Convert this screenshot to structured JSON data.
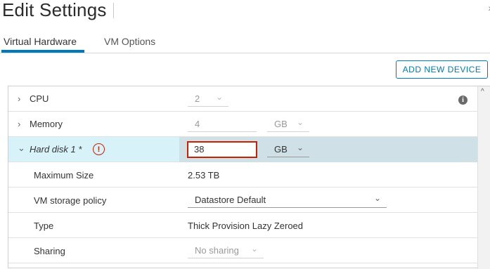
{
  "header": {
    "title": "Edit Settings",
    "close_icon": "close-icon"
  },
  "tabs": [
    {
      "label": "Virtual Hardware",
      "active": true
    },
    {
      "label": "VM Options",
      "active": false
    }
  ],
  "toolbar": {
    "add_device_label": "ADD NEW DEVICE"
  },
  "hardware": {
    "cpu": {
      "label": "CPU",
      "value": "2"
    },
    "memory": {
      "label": "Memory",
      "value": "4",
      "unit": "GB"
    },
    "hard_disk": {
      "label": "Hard disk 1 *",
      "value": "38",
      "unit": "GB",
      "details": {
        "max_size": {
          "label": "Maximum Size",
          "value": "2.53 TB"
        },
        "storage_policy": {
          "label": "VM storage policy",
          "value": "Datastore Default"
        },
        "type": {
          "label": "Type",
          "value": "Thick Provision Lazy Zeroed"
        },
        "sharing": {
          "label": "Sharing",
          "value": "No sharing"
        }
      }
    }
  },
  "icons": {
    "chevron_right": "›",
    "chevron_down": "⌄",
    "warning": "!",
    "info": "i"
  },
  "colors": {
    "accent": "#0079b8",
    "error": "#c92100",
    "highlight_row": "#d8f2f9"
  }
}
